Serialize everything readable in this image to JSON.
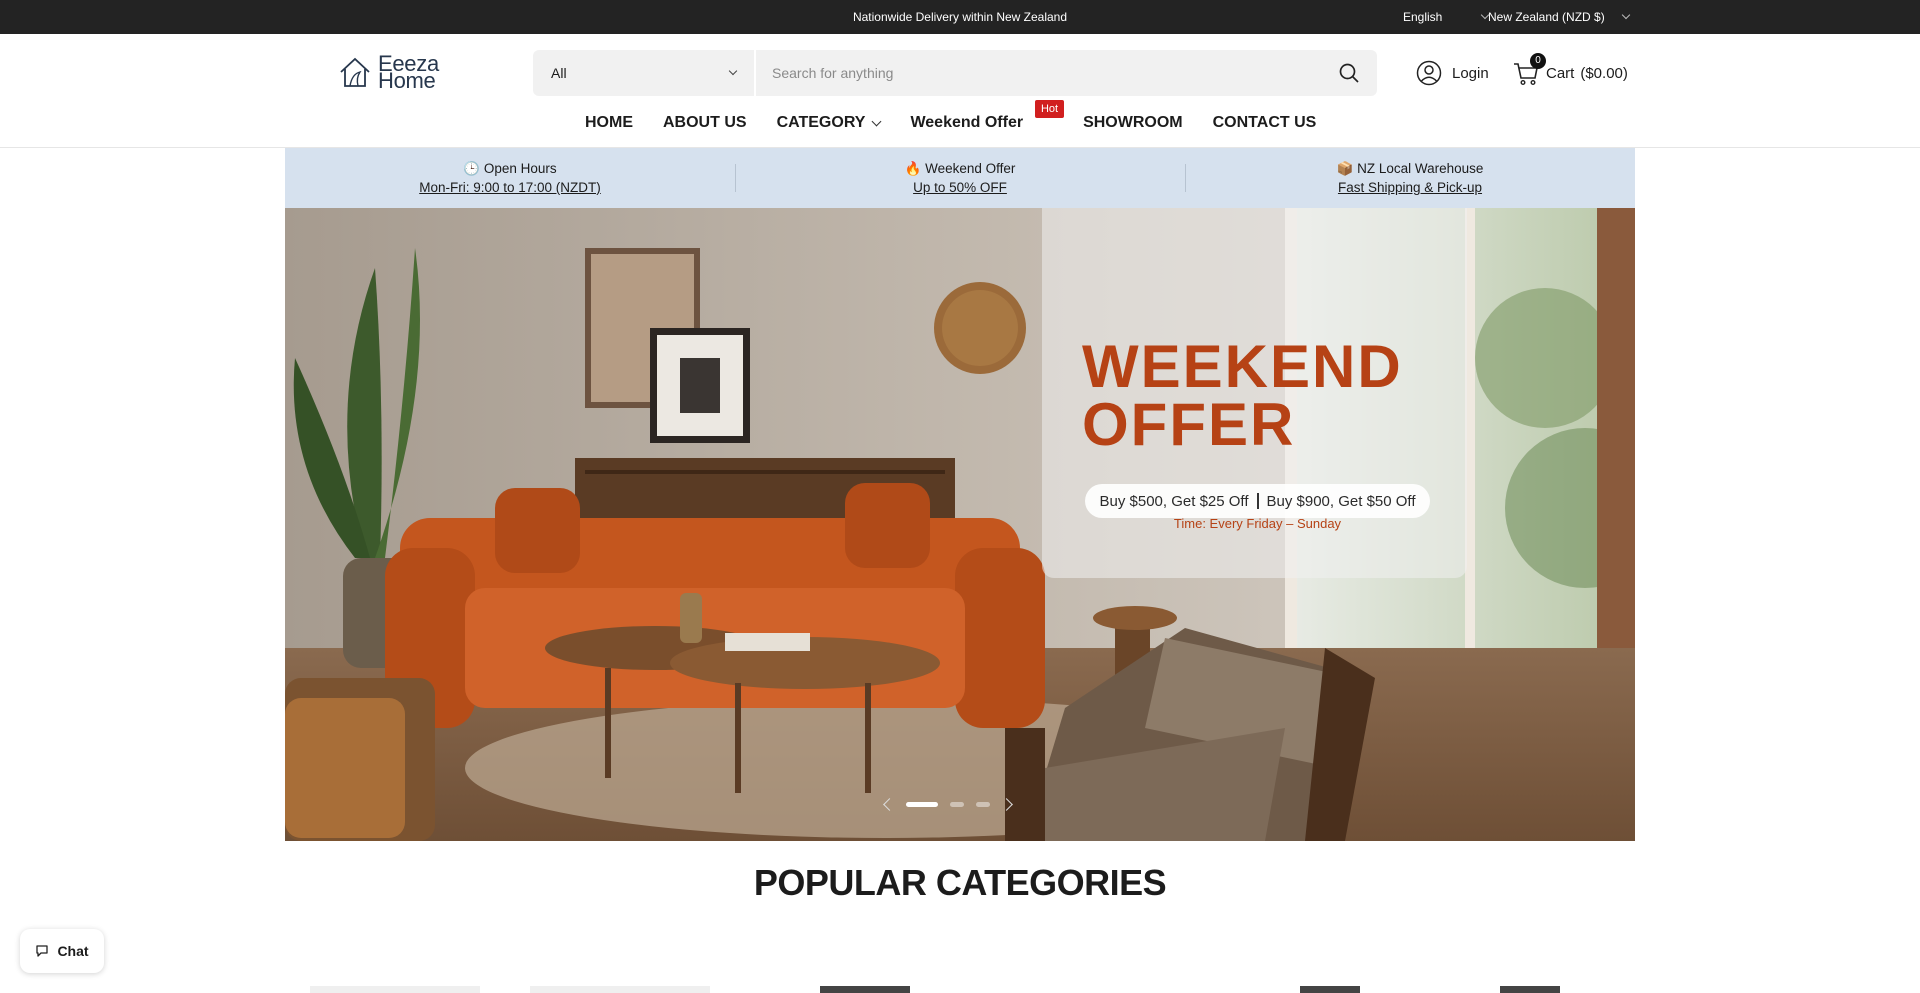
{
  "topbar": {
    "announcement": "Nationwide Delivery within New Zealand",
    "language": "English",
    "currency": "New Zealand (NZD $)"
  },
  "header": {
    "logo_line1": "Eeeza",
    "logo_line2": "Home",
    "search_category": "All",
    "search_placeholder": "Search for anything",
    "login_label": "Login",
    "cart_count": "0",
    "cart_label": "Cart",
    "cart_total": "($0.00)"
  },
  "nav": {
    "items": [
      "HOME",
      "ABOUT US",
      "CATEGORY",
      "Weekend Offer",
      "SHOWROOM",
      "CONTACT US"
    ],
    "hot_badge": "Hot"
  },
  "info_strip": [
    {
      "icon": "clock-icon",
      "title": "🕒 Open Hours",
      "sub": "Mon-Fri: 9:00 to 17:00 (NZDT)"
    },
    {
      "icon": "fire-icon",
      "title": "🔥 Weekend Offer",
      "sub": "Up to 50% OFF"
    },
    {
      "icon": "box-icon",
      "title": "📦 NZ Local Warehouse",
      "sub": "Fast Shipping & Pick-up"
    }
  ],
  "hero": {
    "title_line1": "WEEKEND",
    "title_line2": "OFFER",
    "deal1": "Buy $500, Get $25 Off",
    "deal2": "Buy $900, Get $50 Off",
    "time": "Time: Every Friday – Sunday",
    "slide_count": 3,
    "active_slide": 1
  },
  "popular": {
    "title": "POPULAR CATEGORIES"
  },
  "chat": {
    "label": "Chat"
  },
  "colors": {
    "topbar": "#232323",
    "strip": "#d6e1ee",
    "hot": "#d11f1f",
    "offer": "#b64215"
  }
}
